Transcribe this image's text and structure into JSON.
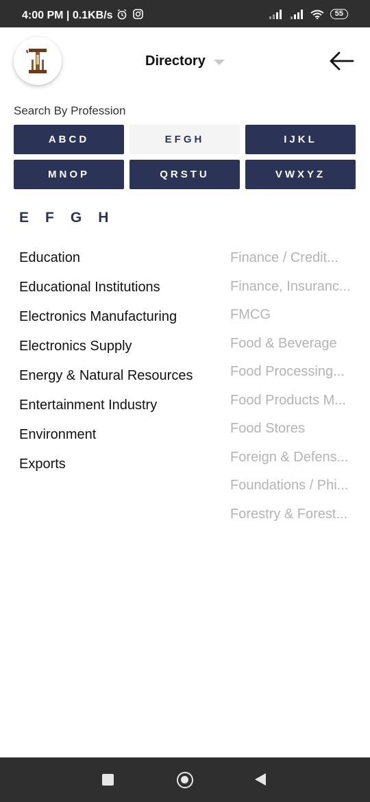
{
  "status_bar": {
    "time": "4:00 PM | 0.1KB/s",
    "battery": "55",
    "icons": [
      "alarm-icon",
      "instagram-icon",
      "signal-icon",
      "signal-icon",
      "wifi-icon",
      "battery-icon"
    ]
  },
  "header": {
    "title": "Directory",
    "logo_icon": "directory-logo-icon",
    "back_icon": "arrow-left-icon"
  },
  "search": {
    "label": "Search By Profession",
    "groups": [
      {
        "label": "ABCD",
        "active": false
      },
      {
        "label": "EFGH",
        "active": true
      },
      {
        "label": "IJKL",
        "active": false
      },
      {
        "label": "MNOP",
        "active": false
      },
      {
        "label": "QRSTU",
        "active": false
      },
      {
        "label": "VWXYZ",
        "active": false
      }
    ]
  },
  "letters": [
    "E",
    "F",
    "G",
    "H"
  ],
  "professions_left": [
    "Education",
    "Educational Institutions",
    "Electronics Manufacturing",
    "Electronics Supply",
    "Energy & Natural Resources",
    "Entertainment Industry",
    "Environment",
    "Exports"
  ],
  "professions_right": [
    "Finance / Credit...",
    "Finance, Insuranc...",
    "FMCG",
    "Food & Beverage",
    "Food Processing...",
    "Food Products M...",
    "Food Stores",
    "Foreign & Defens...",
    "Foundations / Phi...",
    "Forestry & Forest..."
  ],
  "colors": {
    "primary": "#2b3456",
    "active_bg": "#f4f4f4",
    "muted_text": "#b4b4b4",
    "system_bar": "#2f2f2f"
  },
  "nav_bar": {
    "icons": [
      "recent-apps-icon",
      "home-icon",
      "back-icon"
    ]
  }
}
